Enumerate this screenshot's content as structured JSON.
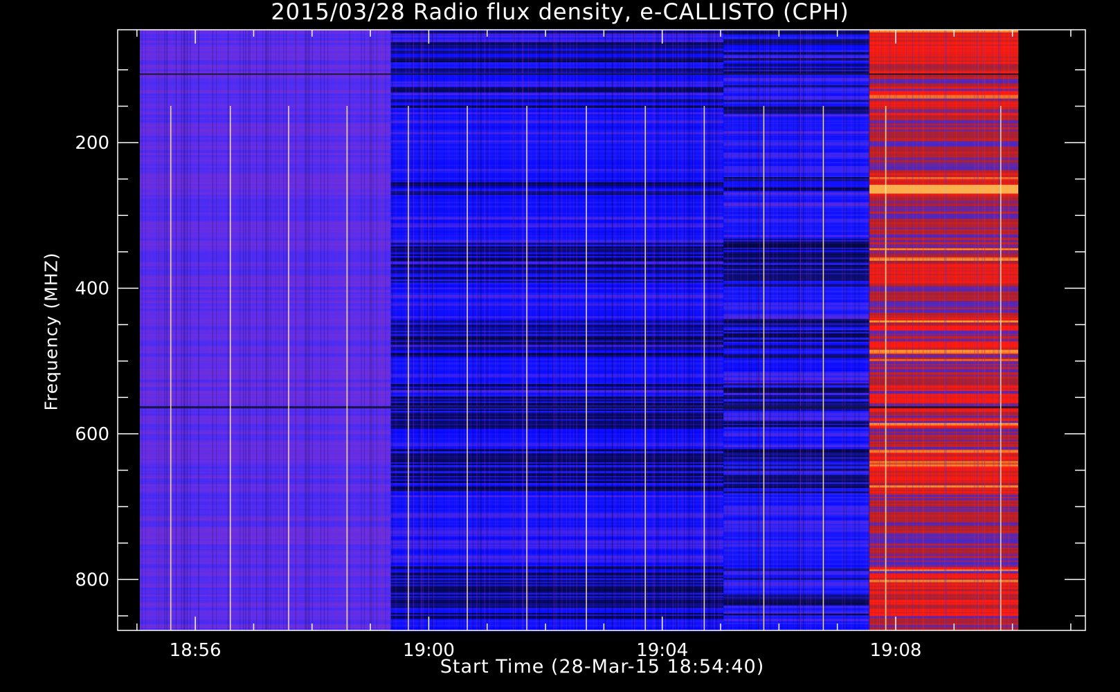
{
  "chart_data": {
    "type": "heatmap",
    "title": "2015/03/28  Radio flux density, e-CALLISTO (CPH)",
    "xlabel": "Start Time (28-Mar-15 18:54:40)",
    "ylabel": "Frequency (MHZ)",
    "x_ticks": [
      "18:56",
      "19:00",
      "19:04",
      "19:08"
    ],
    "x_tick_values_min": [
      1136,
      1140,
      1144,
      1148
    ],
    "xlim_min": [
      1134.67,
      1151.25
    ],
    "y_ticks": [
      200,
      400,
      600,
      800
    ],
    "ylim": [
      870,
      45
    ],
    "inverted_y": true,
    "data_extent": {
      "time_min": [
        1135.05,
        1150.1
      ],
      "freq_mhz": [
        45,
        870
      ]
    },
    "segments": [
      {
        "start_min": 1135.05,
        "end_min": 1139.35,
        "level": "moderate",
        "color": "#5a2ef0"
      },
      {
        "start_min": 1139.35,
        "end_min": 1145.05,
        "level": "low",
        "color": "#1a1aff"
      },
      {
        "start_min": 1145.05,
        "end_min": 1147.55,
        "level": "low",
        "color": "#2222ff"
      },
      {
        "start_min": 1147.55,
        "end_min": 1150.1,
        "level": "high",
        "color": "#c8201e"
      }
    ],
    "bright_vertical_lines_min": [
      1135.58,
      1136.6,
      1137.6,
      1138.6,
      1139.65,
      1140.66,
      1141.68,
      1142.7,
      1143.71,
      1144.72,
      1145.74,
      1146.76,
      1147.83,
      1149.8
    ],
    "strong_bands_mhz": [
      [
        45,
        105
      ],
      [
        120,
        160
      ],
      [
        240,
        275
      ],
      [
        330,
        395
      ],
      [
        440,
        500
      ],
      [
        530,
        590
      ],
      [
        620,
        680
      ],
      [
        780,
        850
      ]
    ],
    "colors": {
      "background": "#000000",
      "axis": "#ffffff",
      "blue": "#1a1aff",
      "violet": "#5a2ef0",
      "red": "#d21e14",
      "yellow": "#ffe060"
    }
  }
}
